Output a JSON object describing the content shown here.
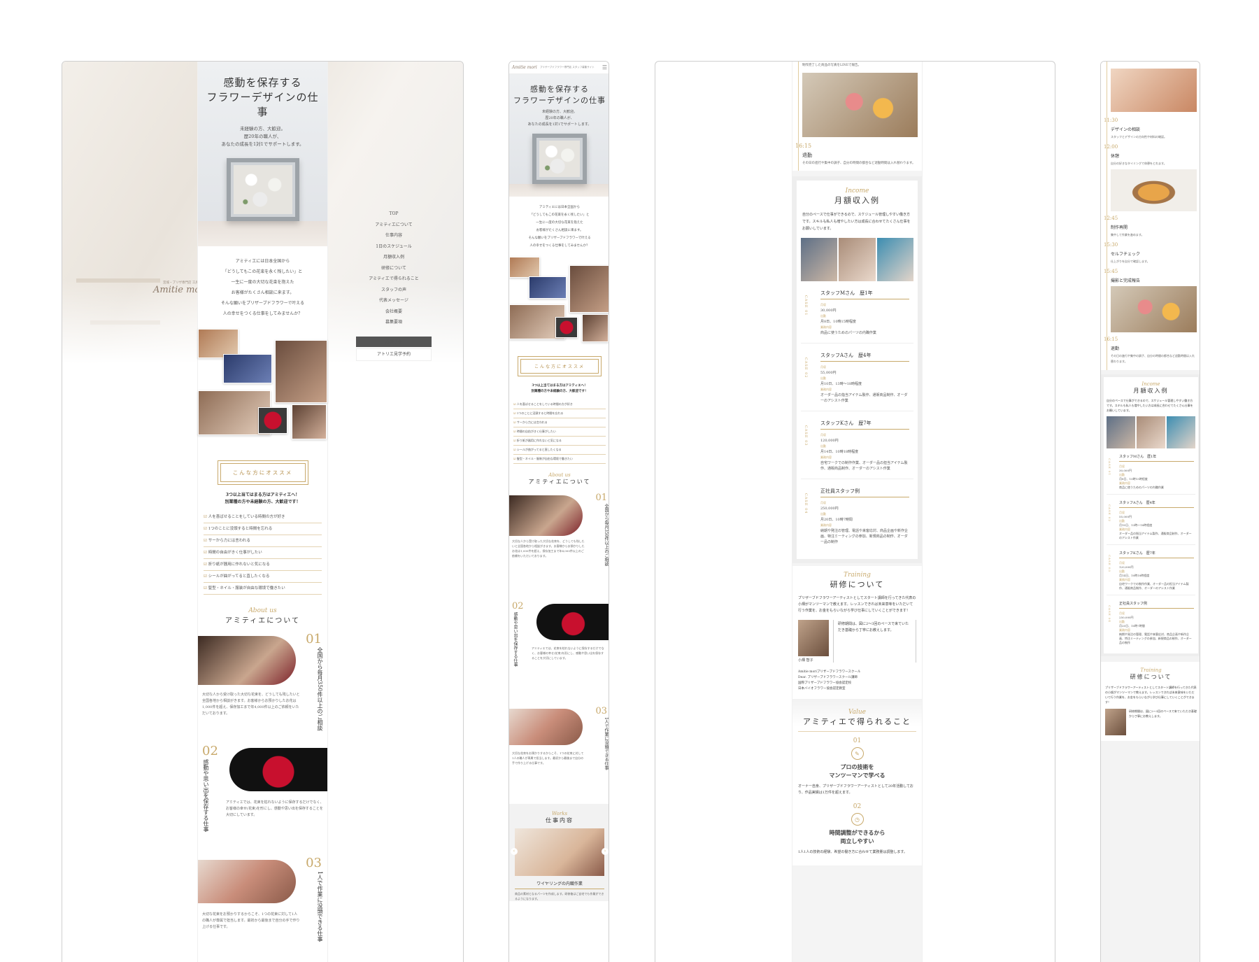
{
  "site": {
    "logo_text": "Amitie mori",
    "logo_sub": "宮城・プリザ専門店 工房ブランド",
    "mobile_header_text": "プリザーブドフラワー専門店 スタッフ募集サイト"
  },
  "hero": {
    "title_line1": "感動を保存する",
    "title_line2": "フラワーデザインの仕事",
    "sub_line1": "未経験の方、大歓迎。",
    "sub_line2": "歴20年の職人が、",
    "sub_line3": "あなたの成長を1対1でサポートします。"
  },
  "intro": [
    "アミティエには日本全国から",
    "「どうしてもこの花束を永く残したい」と",
    "一生に一度の大切な花束を抱えた",
    "お客様がたくさん相談に来ます。",
    "そんな願いをプリザーブドフラワーで叶える",
    "人の幸せをつくる仕事をしてみませんか？"
  ],
  "nav": {
    "items": [
      "TOP",
      "アミティエについて",
      "仕事内容",
      "1日のスケジュール",
      "月額収入例",
      "研修について",
      "アミティエで得られること",
      "スタッフの声",
      "代表メッセージ",
      "会社概要",
      "募集要項"
    ],
    "apply_button": "応募する",
    "visit_button": "アトリエ見学予約"
  },
  "recommend": {
    "box_label": "こんな方にオススメ",
    "lead_line1": "3つ以上当てはまる方はアミティエへ！",
    "lead_line2": "別業種の方や未経験の方、大歓迎です！",
    "checks": [
      "人を喜ばせることをしている時間の方が好き",
      "1つのことに没頭すると時間を忘れる",
      "サーから力には言われる",
      "時間の自由がきく仕事がしたい",
      "折り紙が器用に作れないと気になる",
      "シールが曲がってると直したくなる",
      "髪型・ネイル・服装が自由な環境で働きたい"
    ]
  },
  "about": {
    "en": "About us",
    "jp": "アミティエについて",
    "items": [
      {
        "num": "01",
        "vtitle": "全国から毎月350件以上のご相談",
        "text": "大切な人から受け取った大切な花束を、どうしても残したいと全国各地から相談がきます。お客様からお預かりしたお花は1,000件を超え、保存加工まで年4,000件以上のご依頼をいただいております。"
      },
      {
        "num": "02",
        "vtitle": "感動や思い出を保存する仕事",
        "text": "アミティエでは、花束を枯れないように保存するだけでなく、お客様の幸せ(花束)を形にし、感動や思い出を保存することを大切にしています。"
      },
      {
        "num": "03",
        "vtitle": "1人で作業に没頭できる仕事",
        "text": "大切な花束をお預かりするからこそ、1つの花束に対して1人の職人が専属で担当します。最初から最後まで自分の手で作り上げる仕事です。"
      }
    ]
  },
  "works": {
    "en": "Works",
    "jp": "仕事内容",
    "first_item": "ワイヤリングの内職作業",
    "first_text": "商品の素材となるパーツを作成します。研修後はご自宅でも作業ができるようになります。"
  },
  "schedule": {
    "items": [
      {
        "time": "11:30",
        "head": "デザインの相談",
        "text": "スタッフとデザインの方向性や材料の確認。"
      },
      {
        "time": "12:00",
        "head": "休憩",
        "text": "自分の好きなタイミングで休憩をとれます。"
      },
      {
        "time": "12:45",
        "head": "制作再開",
        "text": "集中して作業を進めます。"
      },
      {
        "time": "15:30",
        "head": "セルフチェック",
        "text": "仕上がりを自分で確認します。"
      },
      {
        "time": "15:45",
        "head": "撮影と完成報告",
        "text": "制作完了した商品の写真をLINEで報告。"
      },
      {
        "time": "16:15",
        "head": "退勤",
        "text": "その日の進行や集中の調子、自分の時間の都合など退勤時間は入れ替わります。"
      }
    ]
  },
  "income": {
    "en": "Income",
    "jp": "月額収入例",
    "lead": "自分のペースで仕事ができるので、スケジュール管理しやすい働き方です。スキルも私人も増やしたい方は成長に合わせてたくさん仕事をお願いしています。",
    "cases": [
      {
        "case": "CASE 01",
        "name": "スタッフMさん　歴1年",
        "salary_label": "月収",
        "salary": "30,000円",
        "days_label": "出勤",
        "days": "月8日、10時15時程度",
        "task_label": "業務内容",
        "task": "商品に使うためのパーツの内職作業"
      },
      {
        "case": "CASE 02",
        "name": "スタッフAさん　歴4年",
        "salary_label": "月収",
        "salary": "55,000円",
        "days_label": "出勤",
        "days": "月10日、13時〜18時程度",
        "task_label": "業務内容",
        "task": "オーダー品の指当アイテム製作、通販商品制作、オーダーのアシスト作業"
      },
      {
        "case": "CASE 03",
        "name": "スタッフKさん　歴7年",
        "salary_label": "月収",
        "salary": "120,000円",
        "days_label": "出勤",
        "days": "月14日、10時18時程度",
        "task_label": "業務内容",
        "task": "自宅ワークでの制作作業、オーダー品の担当アイテム製作、通販商品制作、オーダーのアシスト作業"
      },
      {
        "case": "CASE 04",
        "name": "正社員スタッフ例",
        "salary_label": "月収",
        "salary": "250,000円",
        "days_label": "出勤",
        "days": "月20日、10時7時間",
        "task_label": "業務内容",
        "task": "納期や発注の管理、電話や来客応対、商品企画や新作企画、特注ミーティングの参加、新規商品の制作、オーダー品の制作"
      }
    ]
  },
  "training": {
    "en": "Training",
    "jp": "研修について",
    "lead": "プリザーブドフラワーアーティストとしてスタート講師を行ってきた代表の小畑がマンツーマンで教えます。レッスンできれば未来意味をいただいて行う作業を、お金をもらいながら学び仕事にしていくことができます！",
    "quote": "研修期間は、図に2〜3回のペースで来ていただき基礎から丁寧にお教えします。",
    "person": "小畑 智子",
    "bullets": [
      "Amitie moriプリザーブドフラワースクール",
      "Dear. プリザーブドフラワースクール講師",
      "国際プリザーブドフラワー協会認定校",
      "日本バイオフラワー協会認定教室"
    ]
  },
  "value": {
    "en": "Value",
    "jp": "アミティエで得られること",
    "items": [
      {
        "num": "01",
        "title_line1": "プロの技術を",
        "title_line2": "マンツーマンで学べる",
        "text": "オーナー自身、プリザーブドフラワーアーティストとして20年活動しており、作品実績は1万件を超えます。"
      },
      {
        "num": "02",
        "title_line1": "時間調整ができるから",
        "title_line2": "両立しやすい",
        "text": "1人1人の技術の経験、希望の働き方に合わせて業務量は調整します。"
      }
    ]
  },
  "colors": {
    "accent": "#c8a96b",
    "dark_button": "#555555",
    "card_border": "#eeeeee"
  }
}
